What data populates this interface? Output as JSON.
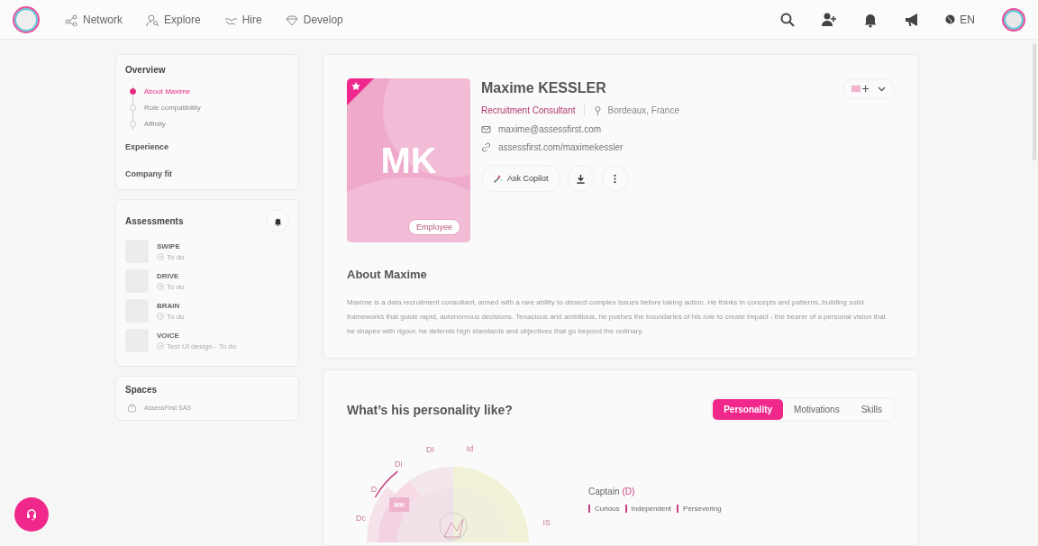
{
  "nav": {
    "items": [
      {
        "label": "Network"
      },
      {
        "label": "Explore"
      },
      {
        "label": "Hire"
      },
      {
        "label": "Develop"
      }
    ],
    "language": "EN"
  },
  "sidebar": {
    "overview": {
      "title": "Overview",
      "items": [
        {
          "label": "About Maxime",
          "selected": true
        },
        {
          "label": "Role compatibility",
          "selected": false
        },
        {
          "label": "Affinity",
          "selected": false
        }
      ]
    },
    "sections": [
      "Experience",
      "Company fit"
    ],
    "assessments": {
      "title": "Assessments",
      "items": [
        {
          "name": "SWIPE",
          "status": "To do"
        },
        {
          "name": "DRIVE",
          "status": "To do"
        },
        {
          "name": "BRAIN",
          "status": "To do"
        },
        {
          "name": "VOICE",
          "status": "Test UI design - To do"
        }
      ]
    },
    "spaces": {
      "title": "Spaces",
      "items": [
        "AssessFirst SAS"
      ]
    }
  },
  "profile": {
    "initials": "MK",
    "favorite": true,
    "badge": "Employee",
    "name": "Maxime KESSLER",
    "role": "Recruitment Consultant",
    "location": "Bordeaux, France",
    "email": "maxime@assessfirst.com",
    "link": "assessfirst.com/maximekessler",
    "ask_button": "Ask Copilot"
  },
  "about": {
    "title": "About Maxime",
    "text": "Maxime is a data recruitment consultant, armed with a rare ability to dissect complex issues before taking action. He thinks in concepts and patterns, building solid frameworks that guide rapid, autonomous decisions. Tenacious and ambitious, he pushes the boundaries of his role to create impact - the bearer of a personal vision that he shapes with rigour, he defends high standards and objectives that go beyond the ordinary."
  },
  "personality": {
    "title": "What’s his personality like?",
    "tabs": [
      {
        "label": "Personality",
        "selected": true
      },
      {
        "label": "Motivations",
        "selected": false
      },
      {
        "label": "Skills",
        "selected": false
      }
    ],
    "wheel": {
      "labels": [
        "Dc",
        "D",
        "Di",
        "DI",
        "Id",
        "IS"
      ],
      "marker": "MK"
    },
    "profile_title": "Captain",
    "profile_code": "(D)",
    "traits": [
      "Curious",
      "Independent",
      "Persevering"
    ]
  }
}
